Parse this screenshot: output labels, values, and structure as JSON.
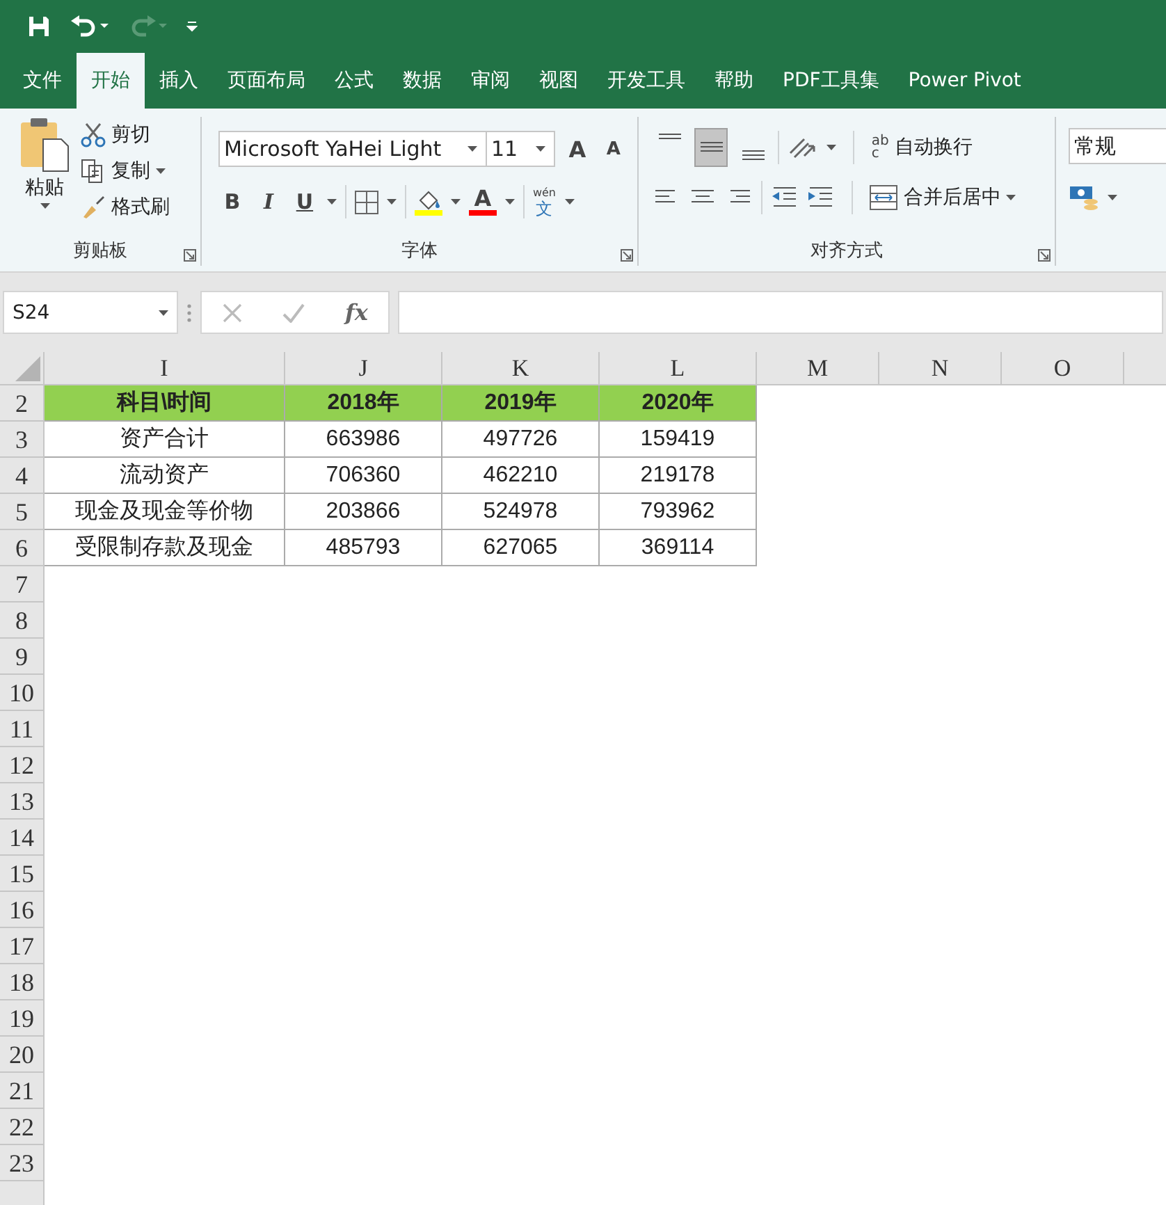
{
  "tabs": [
    {
      "label": "文件",
      "selected": false
    },
    {
      "label": "开始",
      "selected": true
    },
    {
      "label": "插入",
      "selected": false
    },
    {
      "label": "页面布局",
      "selected": false
    },
    {
      "label": "公式",
      "selected": false
    },
    {
      "label": "数据",
      "selected": false
    },
    {
      "label": "审阅",
      "selected": false
    },
    {
      "label": "视图",
      "selected": false
    },
    {
      "label": "开发工具",
      "selected": false
    },
    {
      "label": "帮助",
      "selected": false
    },
    {
      "label": "PDF工具集",
      "selected": false
    },
    {
      "label": "Power Pivot",
      "selected": false
    }
  ],
  "ribbon": {
    "clipboard": {
      "label": "剪贴板",
      "paste": "粘贴",
      "cut": "剪切",
      "copy": "复制",
      "format_painter": "格式刷"
    },
    "font": {
      "label": "字体",
      "font_name": "Microsoft YaHei Light",
      "font_size": "11",
      "grow": "A",
      "shrink": "A",
      "bold": "B",
      "italic": "I",
      "underline": "U",
      "font_color": "A",
      "phonetic_top": "wén",
      "phonetic_bottom": "文"
    },
    "alignment": {
      "label": "对齐方式",
      "vertical": [
        {
          "kind": "top",
          "selected": false
        },
        {
          "kind": "middle",
          "selected": true
        },
        {
          "kind": "bottom",
          "selected": false
        }
      ],
      "wrap_icon": [
        "ab",
        "c"
      ],
      "wrap_text": "自动换行",
      "merge": "合并后居中"
    },
    "number": {
      "format": "常规"
    }
  },
  "formula_bar": {
    "name_box": "S24",
    "fx": "fx"
  },
  "sheet": {
    "columns": [
      "I",
      "J",
      "K",
      "L",
      "M",
      "N",
      "O"
    ],
    "header_row": {
      "number": "2",
      "cells": [
        "科目\\时间",
        "2018年",
        "2019年",
        "2020年"
      ]
    },
    "rows": [
      {
        "number": "3",
        "cells": [
          "资产合计",
          "663986",
          "497726",
          "159419"
        ]
      },
      {
        "number": "4",
        "cells": [
          "流动资产",
          "706360",
          "462210",
          "219178"
        ]
      },
      {
        "number": "5",
        "cells": [
          "现金及现金等价物",
          "203866",
          "524978",
          "793962"
        ]
      },
      {
        "number": "6",
        "cells": [
          "受限制存款及现金",
          "485793",
          "627065",
          "369114"
        ]
      }
    ],
    "empty_rows": [
      "7",
      "8",
      "9",
      "10",
      "11",
      "12",
      "13",
      "14",
      "15",
      "16",
      "17",
      "18",
      "19",
      "20",
      "21",
      "22",
      "23"
    ]
  }
}
